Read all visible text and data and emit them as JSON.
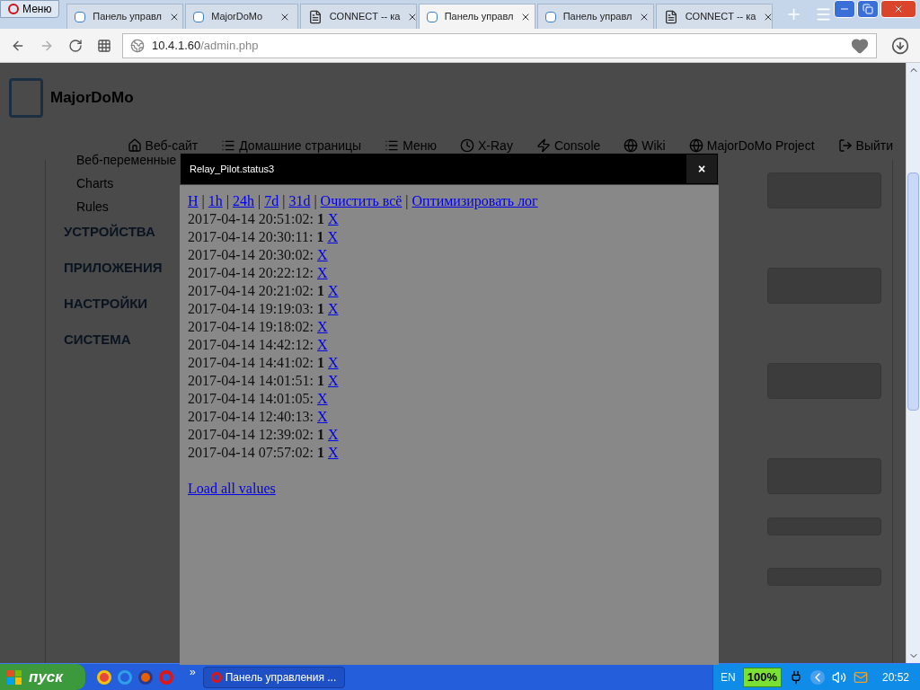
{
  "browser": {
    "menu_button": "Меню",
    "tabs": [
      {
        "title": "Панель управл",
        "kind": "app",
        "selected": false
      },
      {
        "title": "MajorDoMo",
        "kind": "app",
        "selected": false
      },
      {
        "title": "CONNECT -- ка",
        "kind": "page",
        "selected": false
      },
      {
        "title": "Панель управл",
        "kind": "app",
        "selected": true
      },
      {
        "title": "Панель управл",
        "kind": "app",
        "selected": false
      },
      {
        "title": "CONNECT -- ка",
        "kind": "page",
        "selected": false
      }
    ],
    "address": {
      "host": "10.4.1.60",
      "path": "/admin.php"
    }
  },
  "page": {
    "logo": "MajorDoMo",
    "nav": [
      {
        "label": "Веб-сайт",
        "kind": "home"
      },
      {
        "label": "Домашние страницы",
        "kind": "list"
      },
      {
        "label": "Меню",
        "kind": "list"
      },
      {
        "label": "X-Ray",
        "kind": "clock"
      },
      {
        "label": "Console",
        "kind": "bolt"
      },
      {
        "label": "Wiki",
        "kind": "globe"
      },
      {
        "label": "MajorDoMo Project",
        "kind": "globe"
      },
      {
        "label": "Выйти",
        "kind": "logout"
      }
    ],
    "sidebar": {
      "items": [
        "Веб-переменные",
        "Charts",
        "Rules"
      ],
      "sections": [
        "УСТРОЙСТВА",
        "ПРИЛОЖЕНИЯ",
        "НАСТРОЙКИ",
        "СИСТЕМА"
      ]
    }
  },
  "modal": {
    "title": "Relay_Pilot.status3",
    "close": "×",
    "links": [
      "H",
      "1h",
      "24h",
      "7d",
      "31d",
      "Очистить всё",
      "Оптимизировать лог"
    ],
    "separator": "|",
    "entries": [
      {
        "time": "2017-04-14 20:51:02:",
        "value": "1",
        "delete": "X"
      },
      {
        "time": "2017-04-14 20:30:11:",
        "value": "1",
        "delete": "X"
      },
      {
        "time": "2017-04-14 20:30:02:",
        "delete": "X"
      },
      {
        "time": "2017-04-14 20:22:12:",
        "delete": "X"
      },
      {
        "time": "2017-04-14 20:21:02:",
        "value": "1",
        "delete": "X"
      },
      {
        "time": "2017-04-14 19:19:03:",
        "value": "1",
        "delete": "X"
      },
      {
        "time": "2017-04-14 19:18:02:",
        "delete": "X"
      },
      {
        "time": "2017-04-14 14:42:12:",
        "delete": "X"
      },
      {
        "time": "2017-04-14 14:41:02:",
        "value": "1",
        "delete": "X"
      },
      {
        "time": "2017-04-14 14:01:51:",
        "value": "1",
        "delete": "X"
      },
      {
        "time": "2017-04-14 14:01:05:",
        "delete": "X"
      },
      {
        "time": "2017-04-14 12:40:13:",
        "delete": "X"
      },
      {
        "time": "2017-04-14 12:39:02:",
        "value": "1",
        "delete": "X"
      },
      {
        "time": "2017-04-14 07:57:02:",
        "value": "1",
        "delete": "X"
      }
    ],
    "load_all": "Load all values"
  },
  "taskbar": {
    "start": "пуск",
    "more": "»",
    "task": "Панель управления ...",
    "lang": "EN",
    "battery": "100%",
    "time": "20:52"
  }
}
